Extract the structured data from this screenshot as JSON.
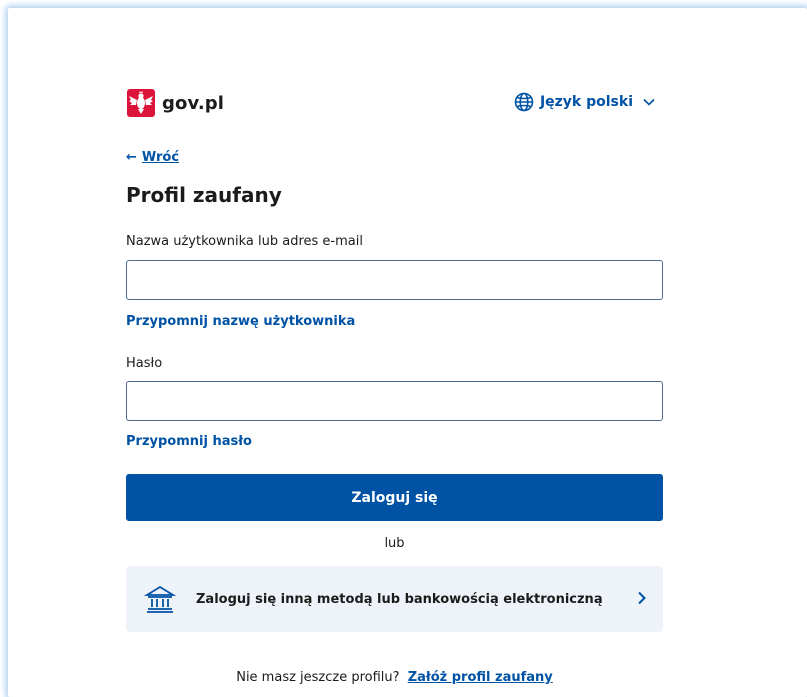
{
  "header": {
    "logo_text": "gov.pl",
    "language_label": "Język polski"
  },
  "nav": {
    "back_arrow": "←",
    "back_label": "Wróć"
  },
  "form": {
    "title": "Profil zaufany",
    "username": {
      "label": "Nazwa użytkownika lub adres e-mail",
      "value": "",
      "placeholder": ""
    },
    "remind_username_label": "Przypomnij nazwę użytkownika",
    "password": {
      "label": "Hasło",
      "value": "",
      "placeholder": ""
    },
    "remind_password_label": "Przypomnij hasło",
    "login_button_label": "Zaloguj się",
    "or_label": "lub",
    "alt_login_label": "Zaloguj się inną metodą lub bankowością elektroniczną"
  },
  "footer": {
    "question": "Nie masz jeszcze profilu?",
    "create_link_label": "Załóż profil zaufany"
  },
  "icons": {
    "logo": "poland-emblem-icon",
    "language": "globe-icon",
    "dropdown": "chevron-down-icon",
    "alt_login": "bank-icon",
    "alt_chevron": "chevron-right-icon"
  },
  "colors": {
    "brand": "#0052a5",
    "emblem_red": "#dc143c",
    "alt_background": "#eef3f9",
    "window_glow": "#b9d6f2"
  }
}
